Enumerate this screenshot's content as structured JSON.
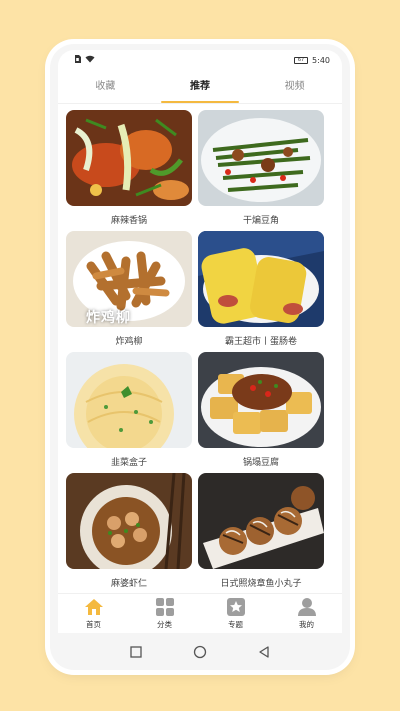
{
  "statusbar": {
    "left_icons": [
      "sim-icon",
      "wifi-icon"
    ],
    "battery": "67",
    "time": "5:40"
  },
  "tabs": [
    {
      "label": "收藏",
      "active": false
    },
    {
      "label": "推荐",
      "active": true
    },
    {
      "label": "视频",
      "active": false
    }
  ],
  "recipes": [
    {
      "label": "麻辣香锅",
      "icon": "food-photo"
    },
    {
      "label": "干煸豆角",
      "icon": "food-photo"
    },
    {
      "label": "炸鸡柳",
      "icon": "food-photo",
      "overlay_text": "炸鸡柳"
    },
    {
      "label": "霸王超市丨蛋肠卷",
      "icon": "food-photo"
    },
    {
      "label": "韭菜盒子",
      "icon": "food-photo"
    },
    {
      "label": "锅塌豆腐",
      "icon": "food-photo"
    },
    {
      "label": "麻婆虾仁",
      "icon": "food-photo"
    },
    {
      "label": "日式照烧章鱼小丸子",
      "icon": "food-photo"
    }
  ],
  "bottom_nav": [
    {
      "label": "首页",
      "icon": "home-icon",
      "active": true
    },
    {
      "label": "分类",
      "icon": "category-icon",
      "active": false
    },
    {
      "label": "专题",
      "icon": "topic-icon",
      "active": false
    },
    {
      "label": "我的",
      "icon": "profile-icon",
      "active": false
    }
  ],
  "colors": {
    "background": "#fde3a6",
    "accent": "#f4b93f",
    "nav_inactive": "#9e9e9e"
  }
}
